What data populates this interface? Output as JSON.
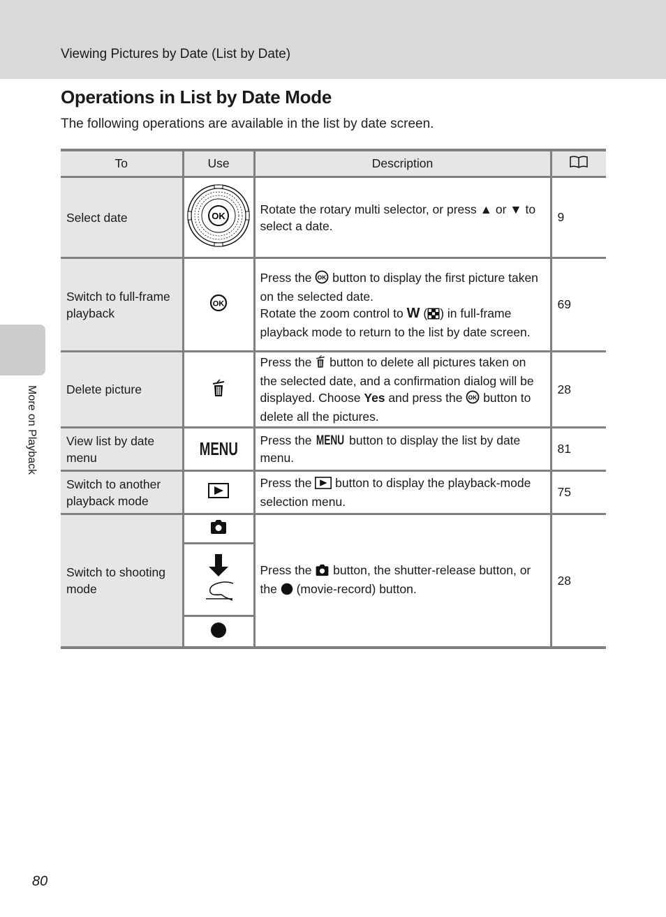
{
  "header": {
    "breadcrumb": "Viewing Pictures by Date (List by Date)"
  },
  "page_title": "Operations in List by Date Mode",
  "intro": "The following operations are available in the list by date screen.",
  "side_tab": {
    "label": "More on Playback"
  },
  "page_number": "80",
  "table": {
    "columns": {
      "to": "To",
      "use": "Use",
      "description": "Description",
      "ref_icon": "book-reference-icon"
    },
    "rows": [
      {
        "to": "Select date",
        "use_icon": "rotary-multi-selector-icon",
        "use_icon_label": "OK",
        "desc": [
          "Rotate the rotary multi selector, or press ",
          " or ",
          " to select a date."
        ],
        "ref": "9"
      },
      {
        "to": "Switch to full-frame playback",
        "use_icon": "ok-button-icon",
        "desc": [
          "Press the ",
          " button to display the first picture taken on the selected date.",
          "Rotate the zoom control to ",
          "W",
          " (",
          ") in full-frame playback mode to return to the list by date screen."
        ],
        "ref": "69"
      },
      {
        "to": "Delete picture",
        "use_icon": "trash-icon",
        "desc": [
          "Press the ",
          " button to delete all pictures taken on the selected date, and a confirmation dialog will be displayed. Choose ",
          "Yes",
          " and press the ",
          " button to delete all the pictures."
        ],
        "ref": "28"
      },
      {
        "to": "View list by date menu",
        "use_icon": "menu-button-icon",
        "use_label": "MENU",
        "desc": [
          "Press the ",
          "MENU",
          " button to display the list by date menu."
        ],
        "ref": "81"
      },
      {
        "to": "Switch to another playback mode",
        "use_icon": "playback-button-icon",
        "desc": [
          "Press the ",
          " button to display the playback-mode selection menu."
        ],
        "ref": "75"
      },
      {
        "to": "Switch to shooting mode",
        "use_icons": [
          "camera-button-icon",
          "shutter-release-press-icon",
          "movie-record-icon"
        ],
        "desc": [
          "Press the ",
          " button, the shutter-release button, or the ",
          " (movie-record) button."
        ],
        "ref": "28"
      }
    ]
  }
}
